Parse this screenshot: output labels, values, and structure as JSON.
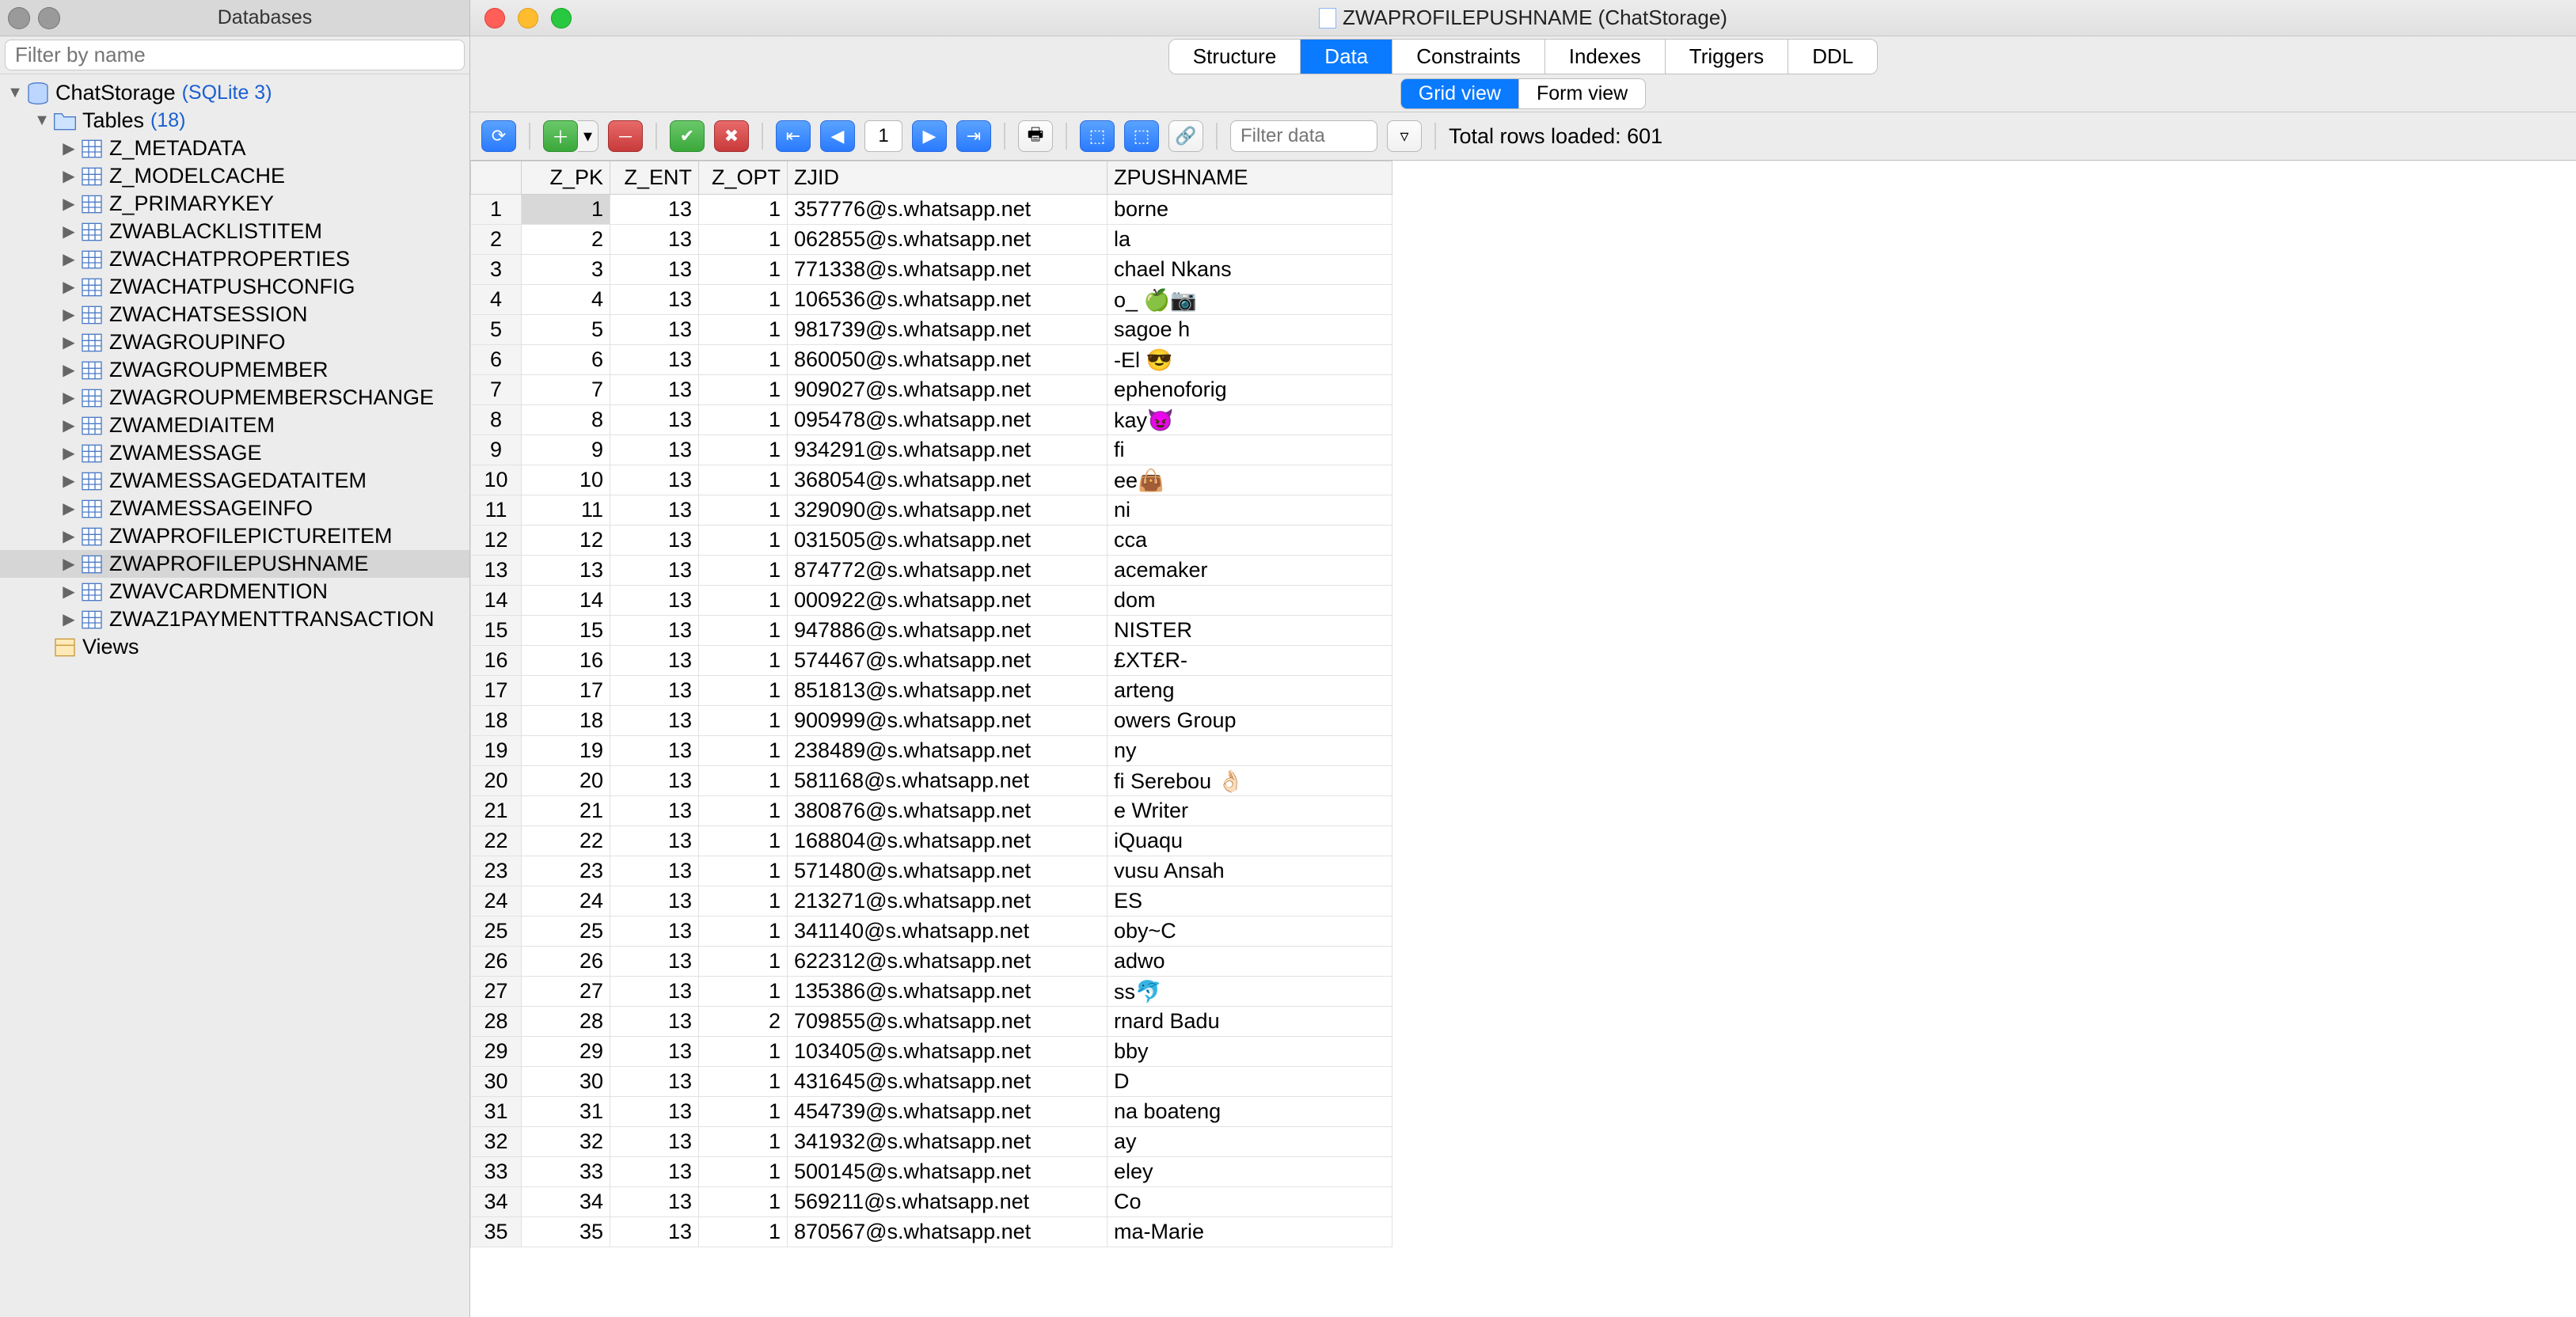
{
  "sidebar": {
    "title": "Databases",
    "filter_placeholder": "Filter by name",
    "db_name": "ChatStorage",
    "db_type": "(SQLite 3)",
    "tables_label": "Tables",
    "tables_count": "(18)",
    "views_label": "Views",
    "tables": [
      "Z_METADATA",
      "Z_MODELCACHE",
      "Z_PRIMARYKEY",
      "ZWABLACKLISTITEM",
      "ZWACHATPROPERTIES",
      "ZWACHATPUSHCONFIG",
      "ZWACHATSESSION",
      "ZWAGROUPINFO",
      "ZWAGROUPMEMBER",
      "ZWAGROUPMEMBERSCHANGE",
      "ZWAMEDIAITEM",
      "ZWAMESSAGE",
      "ZWAMESSAGEDATAITEM",
      "ZWAMESSAGEINFO",
      "ZWAPROFILEPICTUREITEM",
      "ZWAPROFILEPUSHNAME",
      "ZWAVCARDMENTION",
      "ZWAZ1PAYMENTTRANSACTION"
    ],
    "selected_table_index": 15
  },
  "window": {
    "title_table": "ZWAPROFILEPUSHNAME",
    "title_db": "(ChatStorage)"
  },
  "tabs_top": [
    "Structure",
    "Data",
    "Constraints",
    "Indexes",
    "Triggers",
    "DDL"
  ],
  "tabs_top_active": 1,
  "tabs_view": [
    "Grid view",
    "Form view"
  ],
  "tabs_view_active": 0,
  "toolbar": {
    "page": "1",
    "filter_placeholder": "Filter data",
    "rowcount": "Total rows loaded: 601"
  },
  "columns": [
    "",
    "Z_PK",
    "Z_ENT",
    "Z_OPT",
    "ZJID",
    "ZPUSHNAME"
  ],
  "col_classes": [
    "rownum",
    "col-pk num",
    "col-ent num",
    "col-opt num",
    "col-jid",
    "col-push"
  ],
  "rows": [
    [
      1,
      1,
      13,
      1,
      "357776@s.whatsapp.net",
      "borne"
    ],
    [
      2,
      2,
      13,
      1,
      "062855@s.whatsapp.net",
      "la"
    ],
    [
      3,
      3,
      13,
      1,
      "771338@s.whatsapp.net",
      "chael        Nkans"
    ],
    [
      4,
      4,
      13,
      1,
      "106536@s.whatsapp.net",
      "o_ 🍏📷"
    ],
    [
      5,
      5,
      13,
      1,
      "981739@s.whatsapp.net",
      "sagoe        h"
    ],
    [
      6,
      6,
      13,
      1,
      "860050@s.whatsapp.net",
      "-El 😎"
    ],
    [
      7,
      7,
      13,
      1,
      "909027@s.whatsapp.net",
      "ephenoforig"
    ],
    [
      8,
      8,
      13,
      1,
      "095478@s.whatsapp.net",
      "kay😈"
    ],
    [
      9,
      9,
      13,
      1,
      "934291@s.whatsapp.net",
      "fi"
    ],
    [
      10,
      10,
      13,
      1,
      "368054@s.whatsapp.net",
      "ee👜"
    ],
    [
      11,
      11,
      13,
      1,
      "329090@s.whatsapp.net",
      "ni"
    ],
    [
      12,
      12,
      13,
      1,
      "031505@s.whatsapp.net",
      "cca"
    ],
    [
      13,
      13,
      13,
      1,
      "874772@s.whatsapp.net",
      "acemaker"
    ],
    [
      14,
      14,
      13,
      1,
      "000922@s.whatsapp.net",
      "dom"
    ],
    [
      15,
      15,
      13,
      1,
      "947886@s.whatsapp.net",
      "NISTER"
    ],
    [
      16,
      16,
      13,
      1,
      "574467@s.whatsapp.net",
      "£XT£R-"
    ],
    [
      17,
      17,
      13,
      1,
      "851813@s.whatsapp.net",
      "arteng"
    ],
    [
      18,
      18,
      13,
      1,
      "900999@s.whatsapp.net",
      "owers Group"
    ],
    [
      19,
      19,
      13,
      1,
      "238489@s.whatsapp.net",
      "ny"
    ],
    [
      20,
      20,
      13,
      1,
      "581168@s.whatsapp.net",
      "fi Serebou 👌🏻"
    ],
    [
      21,
      21,
      13,
      1,
      "380876@s.whatsapp.net",
      "e Writer"
    ],
    [
      22,
      22,
      13,
      1,
      "168804@s.whatsapp.net",
      "iQuaqu"
    ],
    [
      23,
      23,
      13,
      1,
      "571480@s.whatsapp.net",
      "vusu Ansah"
    ],
    [
      24,
      24,
      13,
      1,
      "213271@s.whatsapp.net",
      "ES"
    ],
    [
      25,
      25,
      13,
      1,
      "341140@s.whatsapp.net",
      "oby~C"
    ],
    [
      26,
      26,
      13,
      1,
      "622312@s.whatsapp.net",
      "adwo"
    ],
    [
      27,
      27,
      13,
      1,
      "135386@s.whatsapp.net",
      "ss🐬"
    ],
    [
      28,
      28,
      13,
      2,
      "709855@s.whatsapp.net",
      "rnard Badu"
    ],
    [
      29,
      29,
      13,
      1,
      "103405@s.whatsapp.net",
      "bby"
    ],
    [
      30,
      30,
      13,
      1,
      "431645@s.whatsapp.net",
      "D"
    ],
    [
      31,
      31,
      13,
      1,
      "454739@s.whatsapp.net",
      "na boateng"
    ],
    [
      32,
      32,
      13,
      1,
      "341932@s.whatsapp.net",
      "ay"
    ],
    [
      33,
      33,
      13,
      1,
      "500145@s.whatsapp.net",
      "eley"
    ],
    [
      34,
      34,
      13,
      1,
      "569211@s.whatsapp.net",
      "Co"
    ],
    [
      35,
      35,
      13,
      1,
      "870567@s.whatsapp.net",
      "ma-Marie"
    ]
  ]
}
